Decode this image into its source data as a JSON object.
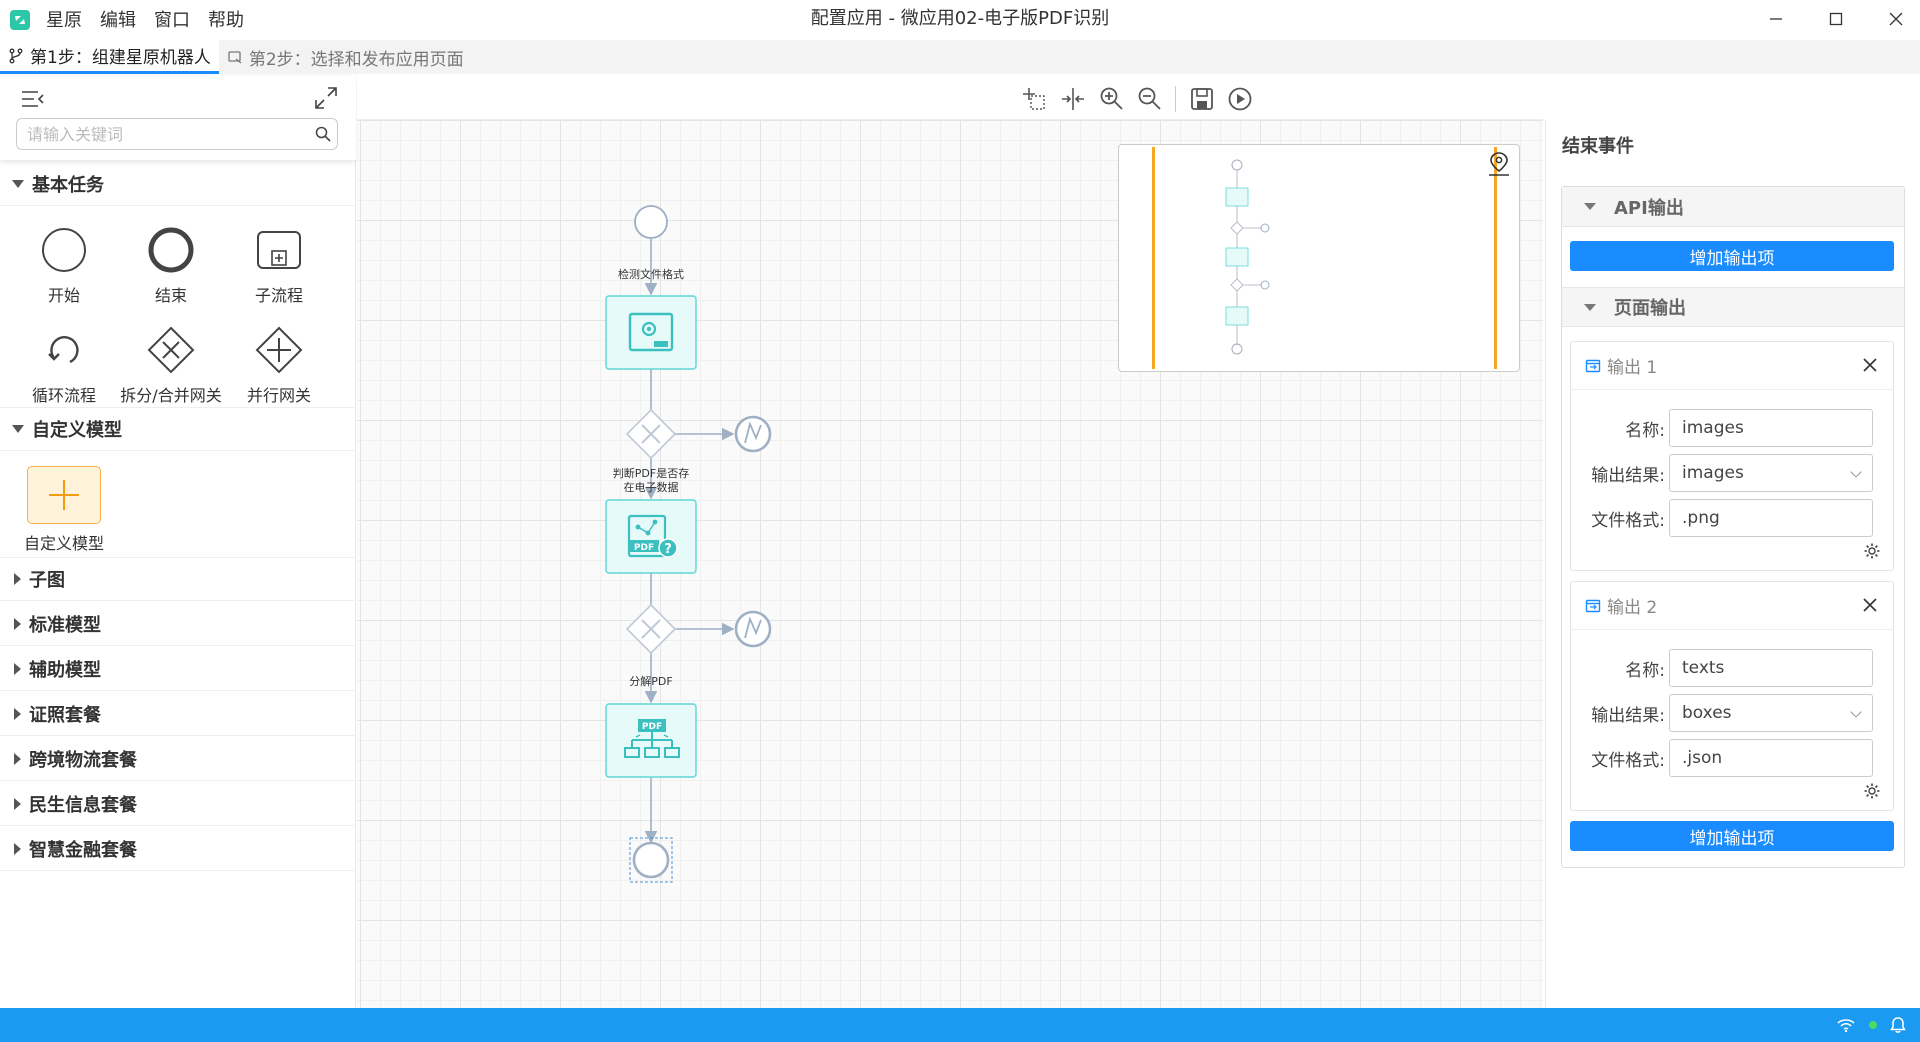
{
  "app": {
    "title": "配置应用 - 微应用02-电子版PDF识别",
    "menu": [
      "星原",
      "编辑",
      "窗口",
      "帮助"
    ]
  },
  "steps": [
    {
      "label": "第1步：组建星原机器人",
      "active": true
    },
    {
      "label": "第2步：选择和发布应用页面",
      "active": false
    }
  ],
  "left_panel": {
    "search_placeholder": "请输入关键词",
    "sections": {
      "basic": "基本任务",
      "custom": "自定义模型",
      "subgraph": "子图",
      "standard": "标准模型",
      "auxiliary": "辅助模型",
      "certificate": "证照套餐",
      "logistics": "跨境物流套餐",
      "livelihood": "民生信息套餐",
      "finance": "智慧金融套餐"
    },
    "basic_items": {
      "start": "开始",
      "end": "结束",
      "subprocess": "子流程",
      "loop": "循环流程",
      "split_merge": "拆分/合并网关",
      "parallel": "并行网关"
    },
    "custom_items": {
      "custom_model": "自定义模型"
    }
  },
  "flow": {
    "tasks": {
      "detect": "检测文件格式",
      "judge_line1": "判断PDF是否存",
      "judge_line2": "在电子数据",
      "split": "分解PDF"
    },
    "pdf_text": "PDF"
  },
  "right_panel": {
    "title": "结束事件",
    "api_section": "API输出",
    "page_section": "页面输出",
    "add_button": "增加输出项",
    "labels": {
      "name": "名称:",
      "result": "输出结果:",
      "format": "文件格式:"
    },
    "outputs": [
      {
        "title": "输出 1",
        "name": "images",
        "result": "images",
        "format": ".png"
      },
      {
        "title": "输出 2",
        "name": "texts",
        "result": "boxes",
        "format": ".json"
      }
    ]
  },
  "colors": {
    "accent": "#1a8cff",
    "status_bar": "#1a9af0",
    "task_fill": "#e6fafa",
    "task_stroke": "#5ed6d6",
    "task_icon": "#3bbfbf",
    "flow_line": "#9fb0c4",
    "minimap_bar": "#f5a623"
  }
}
